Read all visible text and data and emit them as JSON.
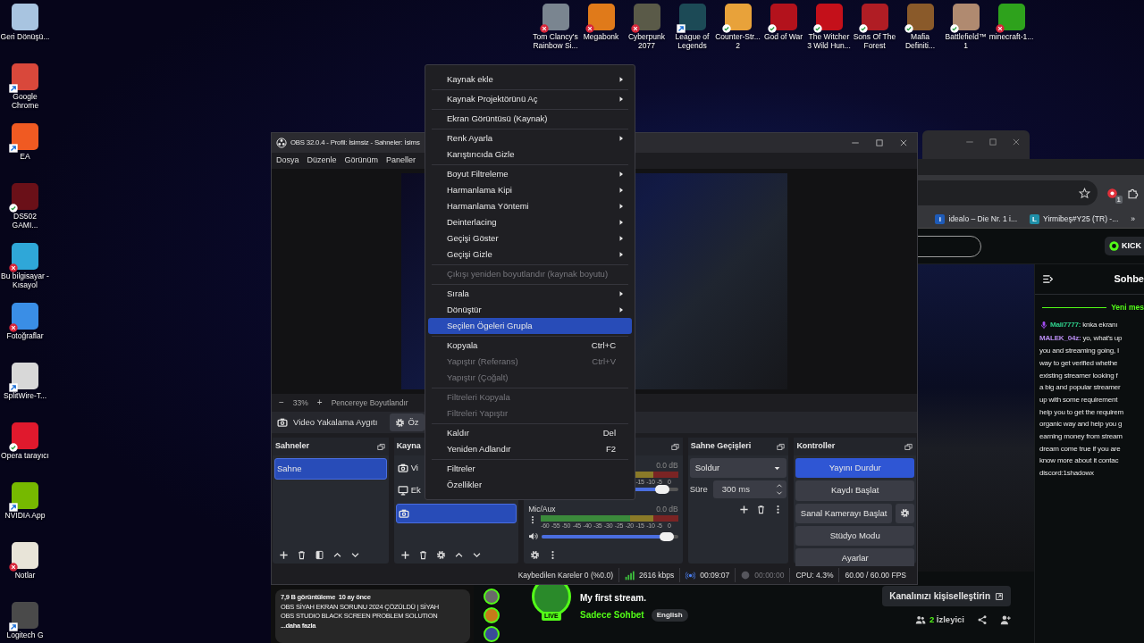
{
  "desktop": {
    "left_icons": [
      {
        "label": "Geri Dönüşü...",
        "kind": "plain",
        "color": "#a8c4e0"
      },
      {
        "label": "Google Chrome",
        "kind": "shortcut",
        "color": "#d9483b"
      },
      {
        "label": "EA",
        "kind": "shortcut",
        "color": "#f05a22"
      },
      {
        "label": "DS502 GAMI...",
        "kind": "synced",
        "color": "#6a1018"
      },
      {
        "label": "Bu bilgisayar - Kısayol",
        "kind": "error",
        "color": "#2fa7d8"
      },
      {
        "label": "Fotoğraflar",
        "kind": "error",
        "color": "#3a8ee6"
      },
      {
        "label": "SplitWire-T...",
        "kind": "shortcut",
        "color": "#d8d8d8"
      },
      {
        "label": "Opera tarayıcı",
        "kind": "synced",
        "color": "#e0192d"
      },
      {
        "label": "NVIDIA App",
        "kind": "shortcut",
        "color": "#76b900"
      },
      {
        "label": "Notlar",
        "kind": "error",
        "color": "#e8e4d8"
      },
      {
        "label": "Logitech G",
        "kind": "shortcut",
        "color": "#4a4a4a"
      }
    ],
    "top_icons": [
      {
        "label": "Tom Clancy's Rainbow Si...",
        "kind": "error",
        "color": "#7a8590"
      },
      {
        "label": "Megabonk",
        "kind": "error",
        "color": "#e07a1a"
      },
      {
        "label": "Cyberpunk 2077",
        "kind": "error",
        "color": "#5a5a48"
      },
      {
        "label": "League of Legends",
        "kind": "shortcut",
        "color": "#1c4a56"
      },
      {
        "label": "Counter-Str... 2",
        "kind": "synced",
        "color": "#e8a23a"
      },
      {
        "label": "God of War",
        "kind": "synced",
        "color": "#b3121c"
      },
      {
        "label": "The Witcher 3 Wild Hun...",
        "kind": "synced",
        "color": "#c4101a"
      },
      {
        "label": "Sons Of The Forest",
        "kind": "synced",
        "color": "#b01d24"
      },
      {
        "label": "Mafia Definiti...",
        "kind": "synced",
        "color": "#8a5a2a"
      },
      {
        "label": "Battlefield™ 1",
        "kind": "synced",
        "color": "#b08a70"
      },
      {
        "label": "minecraft-1...",
        "kind": "error",
        "color": "#2ea21c"
      }
    ]
  },
  "youtube": {
    "views": "7,9 B görüntüleme",
    "age": "10 ay önce",
    "lines": [
      "OBS SİYAH EKRAN SORUNU 2024 ÇÖZÜLDÜ | SİYAH",
      "OBS STUDIO BLACK SCREEN PROBLEM SOLUTION"
    ],
    "more": "...daha fazla"
  },
  "browser": {
    "extension_badge": "1",
    "bookmarks": [
      {
        "favicon": "i",
        "color": "#1e5bb8",
        "label": "idealo – Die Nr. 1 i..."
      },
      {
        "favicon": "L",
        "color": "#1f8fa8",
        "label": "Yirmibeş#Y25 (TR) -..."
      }
    ],
    "bookmarks_more": "»",
    "page": {
      "brand_button": "KICK",
      "chat": {
        "title": "Sohbe",
        "new_messages": "Yeni mes",
        "messages": [
          {
            "user": "Mali7777:",
            "color": "#2fd18c",
            "kind": "mic",
            "lines": [
              "knka ekranı"
            ]
          },
          {
            "user": "MALEK_04z:",
            "color": "#b88cf0",
            "kind": "plain",
            "lines": [
              "yo, what's up",
              "you and streaming going, I",
              "way to get verified whethe",
              "existing streamer looking f",
              "a big and popular streamer",
              "up with some requirement",
              "help you to get the requirem",
              "organic way and help you g",
              "earning money from stream",
              "dream come true if you are",
              "know more about it contac",
              "discord:1shadowx"
            ]
          }
        ]
      },
      "stream": {
        "live_badge": "LIVE",
        "title": "My first stream.",
        "category": "Sadece Sohbet",
        "tag": "English",
        "customize": "Kanalınızı kişiselleştirin",
        "viewer_count": "2",
        "viewer_label": "İzleyici"
      }
    }
  },
  "obs": {
    "title": "OBS 32.0.4 - Profil: İsimsiz - Sahneler: İsims",
    "menu": [
      "Dosya",
      "Düzenle",
      "Görünüm",
      "Paneller"
    ],
    "zoom_bar": {
      "minus": "−",
      "zoom": "33%",
      "plus": "+",
      "fit": "Pencereye Boyutlandır"
    },
    "source_toolbar": {
      "source": "Video Yakalama Aygıtı",
      "properties": "Öz"
    },
    "scenes": {
      "title": "Sahneler",
      "items": [
        {
          "label": "Sahne",
          "selected": true
        }
      ]
    },
    "sources": {
      "title": "Kayna",
      "items": [
        {
          "kind": "camera",
          "label": "Vi",
          "selected": false
        },
        {
          "kind": "display",
          "label": "Ek",
          "selected": false
        },
        {
          "kind": "camera",
          "selected": true
        }
      ]
    },
    "mixer": {
      "channels": [
        {
          "reading": "0.0 dB",
          "scale": [
            "-15",
            "-10",
            "-5",
            "0"
          ],
          "level": 0.92
        },
        {
          "name": "Mic/Aux",
          "reading": "0.0 dB",
          "scale": [
            "-60",
            "-55",
            "-50",
            "-45",
            "-40",
            "-35",
            "-30",
            "-25",
            "-20",
            "-15",
            "-10",
            "-5",
            "0"
          ],
          "level": 0.94
        }
      ]
    },
    "transitions": {
      "title": "Sahne Geçişleri",
      "transition": "Soldur",
      "duration_label": "Süre",
      "duration": "300 ms"
    },
    "controls": {
      "title": "Kontroller",
      "buttons": [
        {
          "label": "Yayını Durdur",
          "active": true,
          "settings": false
        },
        {
          "label": "Kaydı Başlat",
          "active": false,
          "settings": false
        },
        {
          "label": "Sanal Kamerayı Başlat",
          "active": false,
          "settings": true
        },
        {
          "label": "Stüdyo Modu",
          "active": false,
          "settings": false
        },
        {
          "label": "Ayarlar",
          "active": false,
          "settings": false
        }
      ]
    },
    "status_bar": {
      "dropped": "Kaybedilen Kareler 0 (%0.0)",
      "bitrate": "2616 kbps",
      "stream_time": "00:09:07",
      "record_time": "00:00:00",
      "recording": false,
      "cpu": "CPU: 4.3%",
      "fps": "60.00 / 60.00 FPS"
    }
  },
  "context_menu": [
    {
      "kind": "item",
      "label": "Kaynak ekle",
      "submenu": true,
      "disabled": false,
      "selected": false
    },
    {
      "kind": "separator"
    },
    {
      "kind": "item",
      "label": "Kaynak Projektörünü Aç",
      "submenu": true,
      "disabled": false,
      "selected": false
    },
    {
      "kind": "separator"
    },
    {
      "kind": "item",
      "label": "Ekran Görüntüsü (Kaynak)",
      "submenu": false,
      "disabled": false,
      "selected": false
    },
    {
      "kind": "separator"
    },
    {
      "kind": "item",
      "label": "Renk Ayarla",
      "submenu": true,
      "disabled": false,
      "selected": false
    },
    {
      "kind": "item",
      "label": "Karıştırıcıda Gizle",
      "submenu": false,
      "disabled": false,
      "selected": false
    },
    {
      "kind": "separator"
    },
    {
      "kind": "item",
      "label": "Boyut Filtreleme",
      "submenu": true,
      "disabled": false,
      "selected": false
    },
    {
      "kind": "item",
      "label": "Harmanlama Kipi",
      "submenu": true,
      "disabled": false,
      "selected": false
    },
    {
      "kind": "item",
      "label": "Harmanlama Yöntemi",
      "submenu": true,
      "disabled": false,
      "selected": false
    },
    {
      "kind": "item",
      "label": "Deinterlacing",
      "submenu": true,
      "disabled": false,
      "selected": false
    },
    {
      "kind": "item",
      "label": "Geçişi Göster",
      "submenu": true,
      "disabled": false,
      "selected": false
    },
    {
      "kind": "item",
      "label": "Geçişi Gizle",
      "submenu": true,
      "disabled": false,
      "selected": false
    },
    {
      "kind": "separator"
    },
    {
      "kind": "item",
      "label": "Çıkışı yeniden boyutlandır (kaynak boyutu)",
      "submenu": false,
      "disabled": true,
      "selected": false
    },
    {
      "kind": "separator"
    },
    {
      "kind": "item",
      "label": "Sırala",
      "submenu": true,
      "disabled": false,
      "selected": false
    },
    {
      "kind": "item",
      "label": "Dönüştür",
      "submenu": true,
      "disabled": false,
      "selected": false
    },
    {
      "kind": "item",
      "label": "Seçilen Ögeleri Grupla",
      "submenu": false,
      "disabled": false,
      "selected": true
    },
    {
      "kind": "separator"
    },
    {
      "kind": "item",
      "label": "Kopyala",
      "shortcut": "Ctrl+C",
      "submenu": false,
      "disabled": false,
      "selected": false
    },
    {
      "kind": "item",
      "label": "Yapıştır (Referans)",
      "shortcut": "Ctrl+V",
      "submenu": false,
      "disabled": true,
      "selected": false
    },
    {
      "kind": "item",
      "label": "Yapıştır (Çoğalt)",
      "submenu": false,
      "disabled": true,
      "selected": false
    },
    {
      "kind": "separator"
    },
    {
      "kind": "item",
      "label": "Filtreleri Kopyala",
      "submenu": false,
      "disabled": true,
      "selected": false
    },
    {
      "kind": "item",
      "label": "Filtreleri Yapıştır",
      "submenu": false,
      "disabled": true,
      "selected": false
    },
    {
      "kind": "separator"
    },
    {
      "kind": "item",
      "label": "Kaldır",
      "shortcut": "Del",
      "submenu": false,
      "disabled": false,
      "selected": false
    },
    {
      "kind": "item",
      "label": "Yeniden Adlandır",
      "shortcut": "F2",
      "submenu": false,
      "disabled": false,
      "selected": false
    },
    {
      "kind": "separator"
    },
    {
      "kind": "item",
      "label": "Filtreler",
      "submenu": false,
      "disabled": false,
      "selected": false
    },
    {
      "kind": "item",
      "label": "Özellikler",
      "submenu": false,
      "disabled": false,
      "selected": false
    }
  ]
}
